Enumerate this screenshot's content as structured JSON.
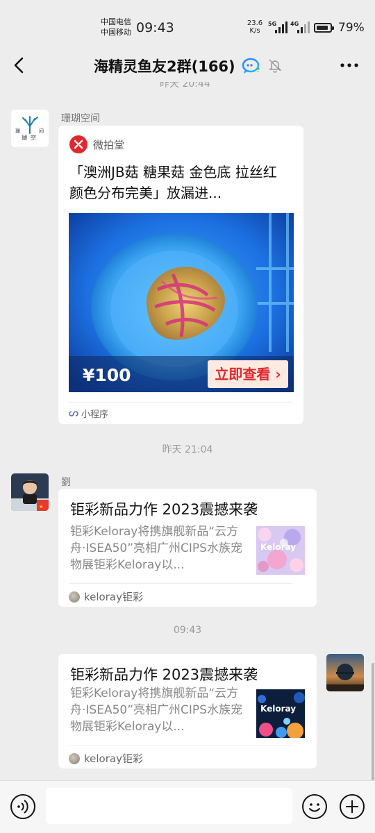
{
  "status_bar": {
    "carrier_1": "中国电信",
    "carrier_2": "中国移动",
    "time": "09:43",
    "net_speed_value": "23.6",
    "net_speed_unit": "K/s",
    "signal_1_label": "5G",
    "signal_2_label": "4G",
    "battery_percent": "79%"
  },
  "header": {
    "title": "海精灵鱼友2群(166)",
    "partial_timestamp": "昨天 20:44"
  },
  "messages": [
    {
      "sender": "珊瑚空间",
      "avatar_text": "珊瑚空间",
      "type": "mini_program",
      "app_name": "微拍堂",
      "title": "「澳洲JB菇 糖果菇 金色底 拉丝红 颜色分布完美」放漏进...",
      "price": "¥100",
      "cta_label": "立即查看 ›",
      "footer_label": "小程序"
    },
    {
      "timestamp": "昨天 21:04",
      "sender": "劉",
      "type": "article",
      "title": "钜彩新品力作 2023震撼来袭",
      "description": "钜彩Keloray将携旗舰新品“云方舟·ISEA50”亮相广州CIPS水族宠物展钜彩Keloray以...",
      "thumb_text": "Keloray",
      "source": "keloray钜彩"
    },
    {
      "timestamp": "09:43",
      "sender": "self",
      "type": "article",
      "title": "钜彩新品力作 2023震撼来袭",
      "description": "钜彩Keloray将携旗舰新品“云方舟·ISEA50”亮相广州CIPS水族宠物展钜彩Keloray以...",
      "thumb_text": "Keloray",
      "source": "keloray钜彩"
    }
  ],
  "input_bar": {
    "voice_icon": "voice-icon",
    "emoji_icon": "emoji-icon",
    "add_icon": "plus-icon"
  },
  "colors": {
    "background": "#ededed",
    "bubble": "#ffffff",
    "mini_program_red": "#e0282e"
  }
}
